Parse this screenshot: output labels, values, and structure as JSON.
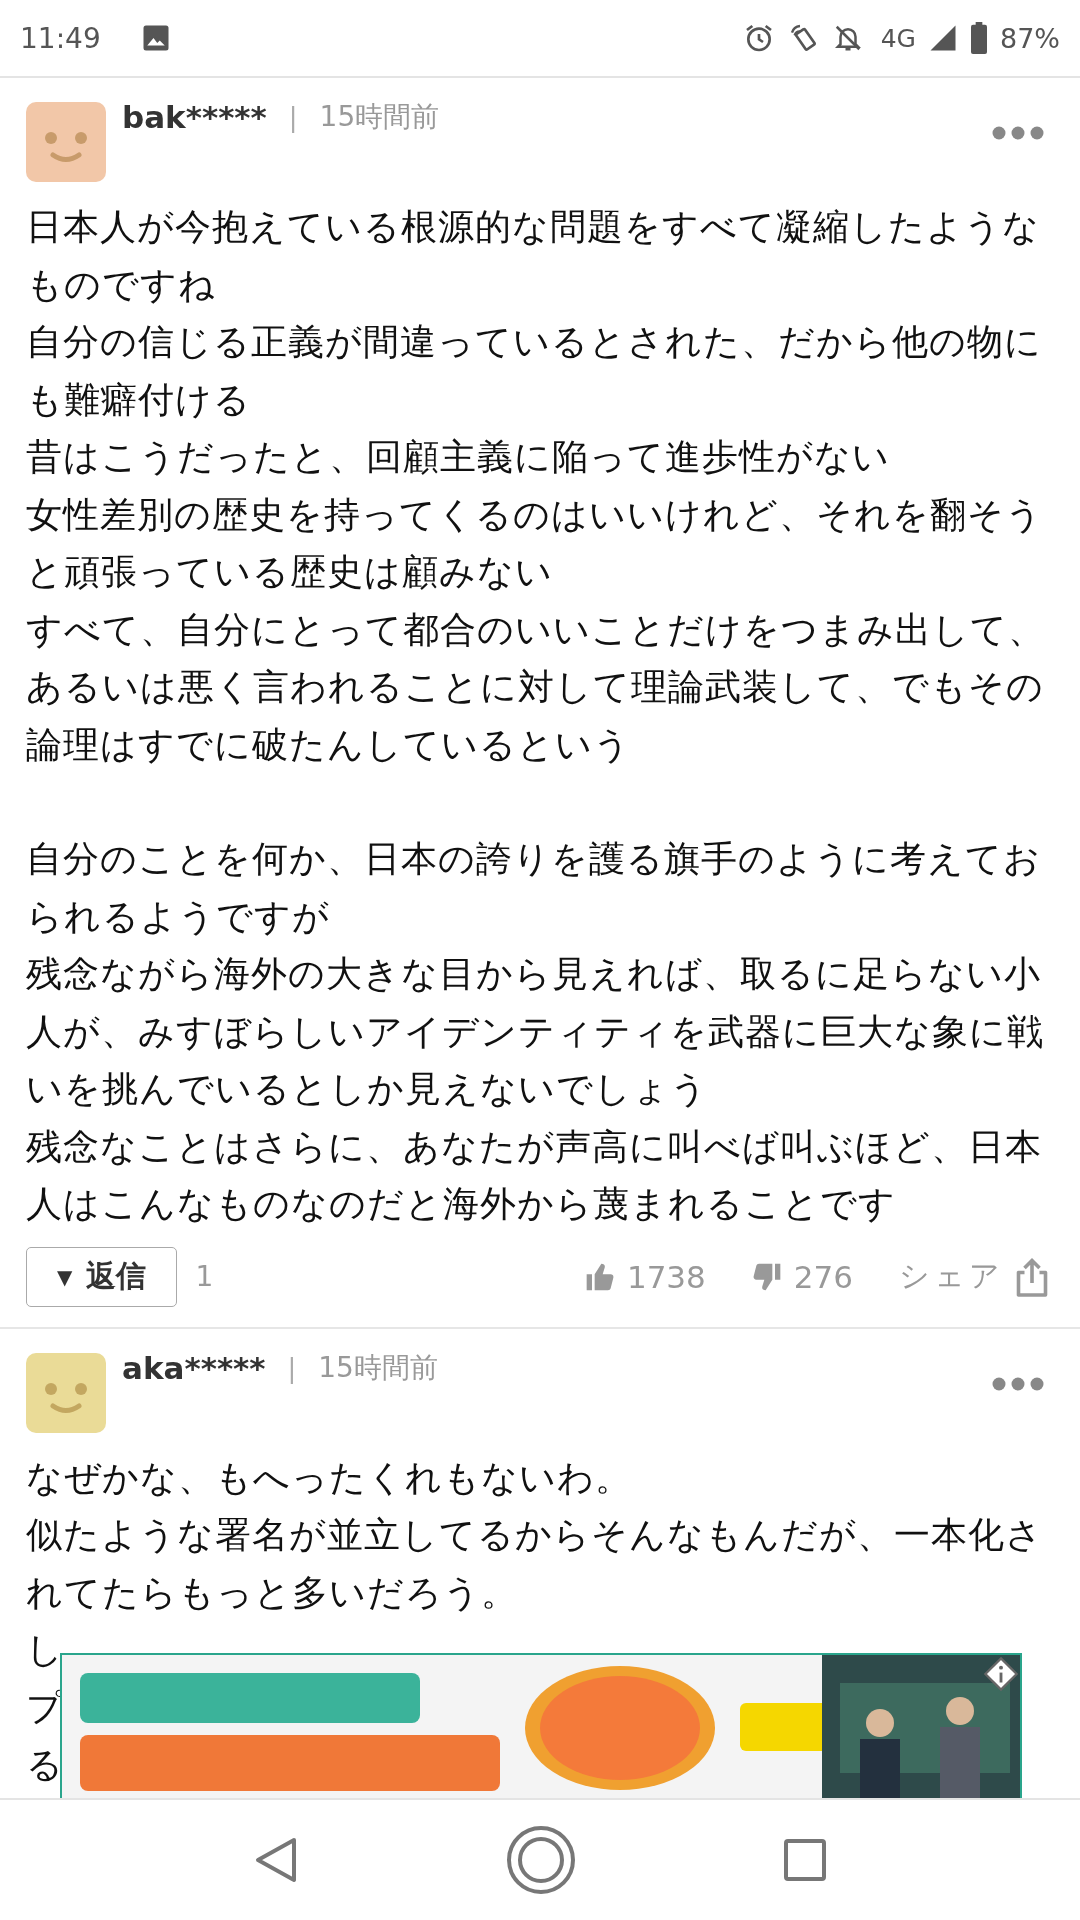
{
  "status_bar": {
    "time": "11:49",
    "network": "4G",
    "battery": "87%"
  },
  "comments": [
    {
      "user": "bak*****",
      "separator": "|",
      "time": "15時間前",
      "color": "#f2c7a8",
      "blocks": [
        [
          "日本人が今抱えている根源的な問題をすべて凝縮したようなものですね",
          "自分の信じる正義が間違っているとされた、だから他の物にも難癖付ける",
          "昔はこうだったと、回顧主義に陥って進歩性がない",
          "女性差別の歴史を持ってくるのはいいけれど、それを翻そうと頑張っている歴史は顧みない",
          "すべて、自分にとって都合のいいことだけをつまみ出して、あるいは悪く言われることに対して理論武装して、でもその論理はすでに破たんしているという"
        ],
        [
          "自分のことを何か、日本の誇りを護る旗手のように考えておられるようですが",
          "残念ながら海外の大きな目から見えれば、取るに足らない小人が、みすぼらしいアイデンティティを武器に巨大な象に戦いを挑んでいるとしか見えないでしょう",
          "残念なことはさらに、あなたが声高に叫べば叫ぶほど、日本人はこんなものなのだと海外から蔑まれることです"
        ]
      ],
      "actions": {
        "reply_arrow": "▼",
        "reply_label": "返信",
        "reply_count": "1",
        "likes": "1738",
        "dislikes": "276",
        "share": "シェア"
      }
    },
    {
      "user": "aka*****",
      "separator": "|",
      "time": "15時間前",
      "color": "#eadb97",
      "blocks": [
        [
          "なぜかな、もへったくれもないわ。",
          "似たような署名が並立してるからそんなもんだが、一本化されてたらもっと多いだろう。",
          "し",
          "プ",
          "る"
        ]
      ]
    }
  ]
}
